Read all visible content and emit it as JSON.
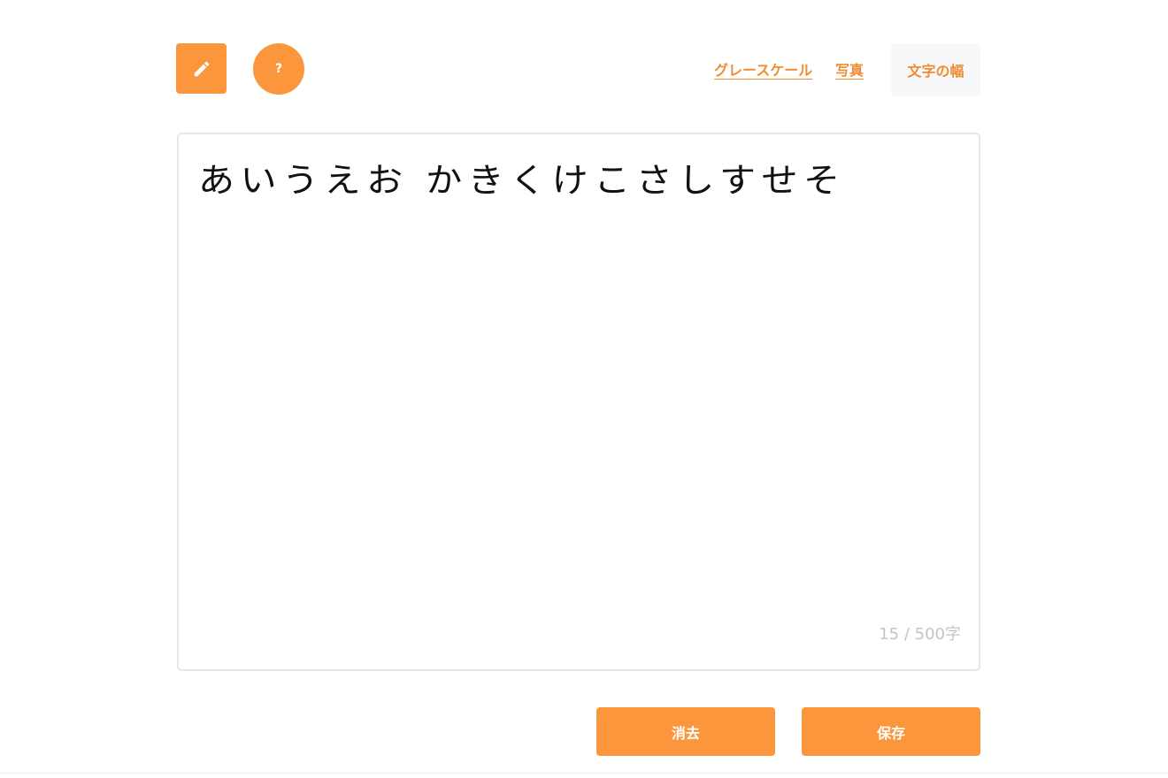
{
  "toolbar": {
    "edit_icon": "pencil-icon",
    "help_label": "?",
    "grayscale_label": "グレースケール",
    "photo_label": "写真",
    "char_width_label": "文字の幅"
  },
  "editor": {
    "text": "あいうえお かきくけこさしすせそ",
    "counter": "15 / 500字"
  },
  "actions": {
    "clear_label": "消去",
    "save_label": "保存"
  },
  "colors": {
    "accent": "#fc963c",
    "link": "#f08c33",
    "counter": "#c2c4c9"
  }
}
